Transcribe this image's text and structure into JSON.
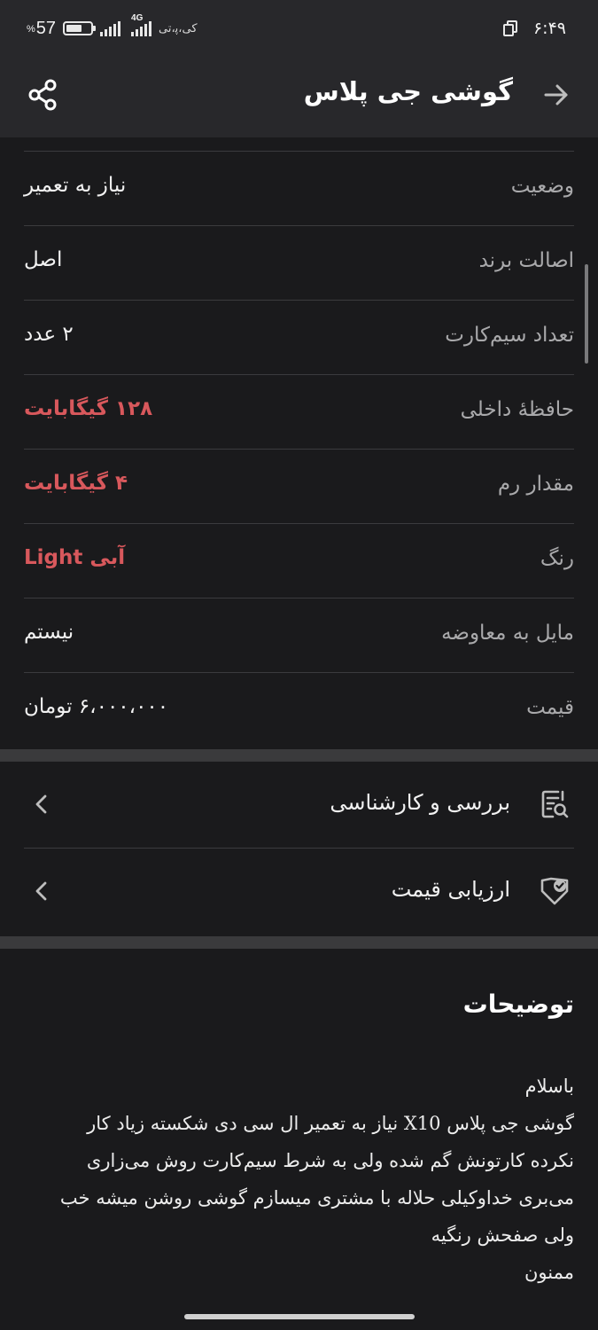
{
  "status_bar": {
    "battery_percent": "57",
    "percent_sign": "%",
    "network_type": "4G",
    "carrier": "ﮐﯽ،ﭘ،ﺗﯽ",
    "time": "۶:۴۹"
  },
  "header": {
    "title": "گوشی جی پلاس",
    "back_icon": "arrow-right-icon",
    "share_icon": "share-icon"
  },
  "specs": [
    {
      "label": "وضعیت",
      "value": "نیاز به تعمیر",
      "highlight": false
    },
    {
      "label": "اصالت برند",
      "value": "اصل",
      "highlight": false
    },
    {
      "label": "تعداد سیم‌کارت",
      "value": "۲ عدد",
      "highlight": false
    },
    {
      "label": "حافظهٔ داخلی",
      "value": "۱۲۸ گیگابایت",
      "highlight": true
    },
    {
      "label": "مقدار رم",
      "value": "۴ گیگابایت",
      "highlight": true
    },
    {
      "label": "رنگ",
      "value": "آبی Light",
      "highlight": true
    },
    {
      "label": "مایل به معاوضه",
      "value": "نیستم",
      "highlight": false
    },
    {
      "label": "قیمت",
      "value": "۶،۰۰۰،۰۰۰ تومان",
      "highlight": false
    }
  ],
  "links": [
    {
      "label": "بررسی و کارشناسی",
      "icon": "inspection-icon"
    },
    {
      "label": "ارزیابی قیمت",
      "icon": "price-tag-check-icon"
    }
  ],
  "colors": {
    "background": "#1a1a1c",
    "bar": "#28282b",
    "highlight": "#d8585c",
    "muted": "#a9a9ab"
  },
  "description": {
    "title": "توضیحات",
    "lines": [
      "باسلام",
      "گوشی جی پلاس X10 نیاز به تعمیر ال سی دی شکسته زیاد کار",
      "نکرده کارتونش گم شده ولی به شرط سیم‌کارت روش می‌زاری",
      "می‌بری خداوکیلی حلاله با مشتری میسازم گوشی روشن میشه خب",
      "ولی صفحش رنگیه",
      "ممنون"
    ]
  }
}
